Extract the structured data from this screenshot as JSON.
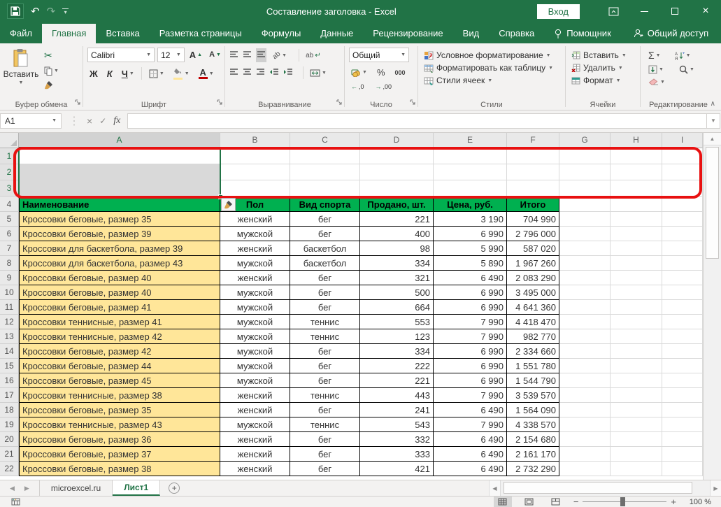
{
  "titlebar": {
    "title": "Составление заголовка  -  Excel",
    "sign_in": "Вход"
  },
  "tab_row": {
    "tabs": [
      {
        "id": "file",
        "label": "Файл",
        "active": false,
        "icon": ""
      },
      {
        "id": "home",
        "label": "Главная",
        "active": true,
        "icon": ""
      },
      {
        "id": "insert",
        "label": "Вставка",
        "active": false,
        "icon": ""
      },
      {
        "id": "page-layout",
        "label": "Разметка страницы",
        "active": false,
        "icon": ""
      },
      {
        "id": "formulas",
        "label": "Формулы",
        "active": false,
        "icon": ""
      },
      {
        "id": "data",
        "label": "Данные",
        "active": false,
        "icon": ""
      },
      {
        "id": "review",
        "label": "Рецензирование",
        "active": false,
        "icon": ""
      },
      {
        "id": "view",
        "label": "Вид",
        "active": false,
        "icon": ""
      },
      {
        "id": "help",
        "label": "Справка",
        "active": false,
        "icon": ""
      },
      {
        "id": "assistant",
        "label": "Помощник",
        "active": false,
        "icon": "bulb"
      }
    ],
    "share": "Общий доступ"
  },
  "ribbon": {
    "groups": [
      "Буфер обмена",
      "Шрифт",
      "Выравнивание",
      "Число",
      "Стили",
      "Ячейки",
      "Редактирование"
    ],
    "paste": "Вставить",
    "font_name": "Calibri",
    "font_size": "12",
    "bold": "Ж",
    "italic": "К",
    "underline": "Ч",
    "number_format": "Общий",
    "percent": "%",
    "thousands": "000",
    "styles": [
      "Условное форматирование",
      "Форматировать как таблицу",
      "Стили ячеек"
    ],
    "cells": [
      "Вставить",
      "Удалить",
      "Формат"
    ],
    "sigma": "Σ"
  },
  "formula_bar": {
    "name_box": "A1",
    "value": ""
  },
  "grid": {
    "columns": [
      "A",
      "B",
      "C",
      "D",
      "E",
      "F",
      "G",
      "H",
      "I"
    ]
  },
  "sheet": {
    "empty_row_numbers": [
      "1",
      "2",
      "3"
    ],
    "header_row": {
      "n": "4",
      "cells": [
        "Наименование",
        "Пол",
        "Вид спорта",
        "Продано, шт.",
        "Цена, руб.",
        "Итого"
      ]
    },
    "rows": [
      {
        "n": "5",
        "name": "Кроссовки беговые, размер 35",
        "gender": "женский",
        "sport": "бег",
        "sold": "221",
        "price": "3 190",
        "total": "704 990"
      },
      {
        "n": "6",
        "name": "Кроссовки беговые, размер 39",
        "gender": "мужской",
        "sport": "бег",
        "sold": "400",
        "price": "6 990",
        "total": "2 796 000"
      },
      {
        "n": "7",
        "name": "Кроссовки для баскетбола, размер 39",
        "gender": "женский",
        "sport": "баскетбол",
        "sold": "98",
        "price": "5 990",
        "total": "587 020"
      },
      {
        "n": "8",
        "name": "Кроссовки для баскетбола, размер 43",
        "gender": "мужской",
        "sport": "баскетбол",
        "sold": "334",
        "price": "5 890",
        "total": "1 967 260"
      },
      {
        "n": "9",
        "name": "Кроссовки беговые, размер 40",
        "gender": "женский",
        "sport": "бег",
        "sold": "321",
        "price": "6 490",
        "total": "2 083 290"
      },
      {
        "n": "10",
        "name": "Кроссовки беговые, размер 40",
        "gender": "мужской",
        "sport": "бег",
        "sold": "500",
        "price": "6 990",
        "total": "3 495 000"
      },
      {
        "n": "11",
        "name": "Кроссовки беговые, размер 41",
        "gender": "мужской",
        "sport": "бег",
        "sold": "664",
        "price": "6 990",
        "total": "4 641 360"
      },
      {
        "n": "12",
        "name": "Кроссовки теннисные, размер 41",
        "gender": "мужской",
        "sport": "теннис",
        "sold": "553",
        "price": "7 990",
        "total": "4 418 470"
      },
      {
        "n": "13",
        "name": "Кроссовки теннисные, размер 42",
        "gender": "мужской",
        "sport": "теннис",
        "sold": "123",
        "price": "7 990",
        "total": "982 770"
      },
      {
        "n": "14",
        "name": "Кроссовки беговые, размер 42",
        "gender": "мужской",
        "sport": "бег",
        "sold": "334",
        "price": "6 990",
        "total": "2 334 660"
      },
      {
        "n": "15",
        "name": "Кроссовки беговые, размер 44",
        "gender": "мужской",
        "sport": "бег",
        "sold": "222",
        "price": "6 990",
        "total": "1 551 780"
      },
      {
        "n": "16",
        "name": "Кроссовки беговые, размер 45",
        "gender": "мужской",
        "sport": "бег",
        "sold": "221",
        "price": "6 990",
        "total": "1 544 790"
      },
      {
        "n": "17",
        "name": "Кроссовки теннисные, размер 38",
        "gender": "женский",
        "sport": "теннис",
        "sold": "443",
        "price": "7 990",
        "total": "3 539 570"
      },
      {
        "n": "18",
        "name": "Кроссовки беговые, размер 35",
        "gender": "женский",
        "sport": "бег",
        "sold": "241",
        "price": "6 490",
        "total": "1 564 090"
      },
      {
        "n": "19",
        "name": "Кроссовки теннисные, размер 43",
        "gender": "мужской",
        "sport": "теннис",
        "sold": "543",
        "price": "7 990",
        "total": "4 338 570"
      },
      {
        "n": "20",
        "name": "Кроссовки беговые, размер 36",
        "gender": "женский",
        "sport": "бег",
        "sold": "332",
        "price": "6 490",
        "total": "2 154 680"
      },
      {
        "n": "21",
        "name": "Кроссовки беговые, размер 37",
        "gender": "женский",
        "sport": "бег",
        "sold": "333",
        "price": "6 490",
        "total": "2 161 170"
      },
      {
        "n": "22",
        "name": "Кроссовки беговые, размер 38",
        "gender": "женский",
        "sport": "бег",
        "sold": "421",
        "price": "6 490",
        "total": "2 732 290"
      }
    ]
  },
  "sheet_tabs": {
    "tabs": [
      "microexcel.ru",
      "Лист1"
    ]
  },
  "status_bar": {
    "zoom": "100 %"
  },
  "colors": {
    "brand_green": "#217346",
    "table_header_green": "#00b050",
    "name_column_yellow": "#ffe699",
    "annotation_red": "#e81111"
  }
}
